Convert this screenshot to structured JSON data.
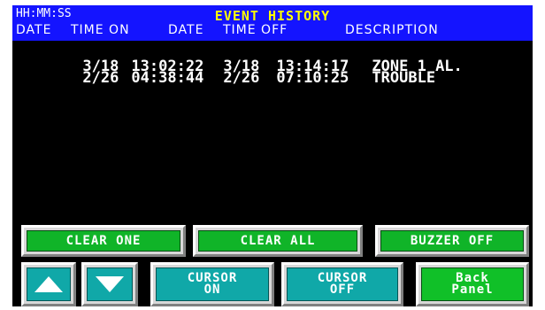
{
  "header": {
    "clock_format": "HH:MM:SS",
    "title": "EVENT HISTORY",
    "columns": {
      "date_on": "DATE",
      "time_on": "TIME ON",
      "date_off": "DATE",
      "time_off": "TIME OFF",
      "description": "DESCRIPTION"
    }
  },
  "events": [
    {
      "date_on": "3/18",
      "time_on": "13:02:22",
      "date_off": "3/18",
      "time_off": "13:14:17",
      "description": "ZONE 1 AL."
    },
    {
      "date_on": "2/26",
      "time_on": "04:38:44",
      "date_off": "2/26",
      "time_off": "07:10:25",
      "description": "TROUBLE"
    }
  ],
  "buttons": {
    "clear_one": "CLEAR ONE",
    "clear_all": "CLEAR ALL",
    "buzzer_off": "BUZZER OFF",
    "cursor_on": [
      "CURSOR",
      "ON"
    ],
    "cursor_off": [
      "CURSOR",
      "OFF"
    ],
    "back_panel": [
      "Back",
      "Panel"
    ]
  },
  "icons": {
    "scroll_up": "up-arrow-icon",
    "scroll_down": "down-arrow-icon"
  },
  "colors": {
    "header_bg": "#1414ff",
    "title": "#ffff00",
    "screen_bg": "#000000",
    "green_button": "#10b428",
    "teal_button": "#10a8a8"
  }
}
